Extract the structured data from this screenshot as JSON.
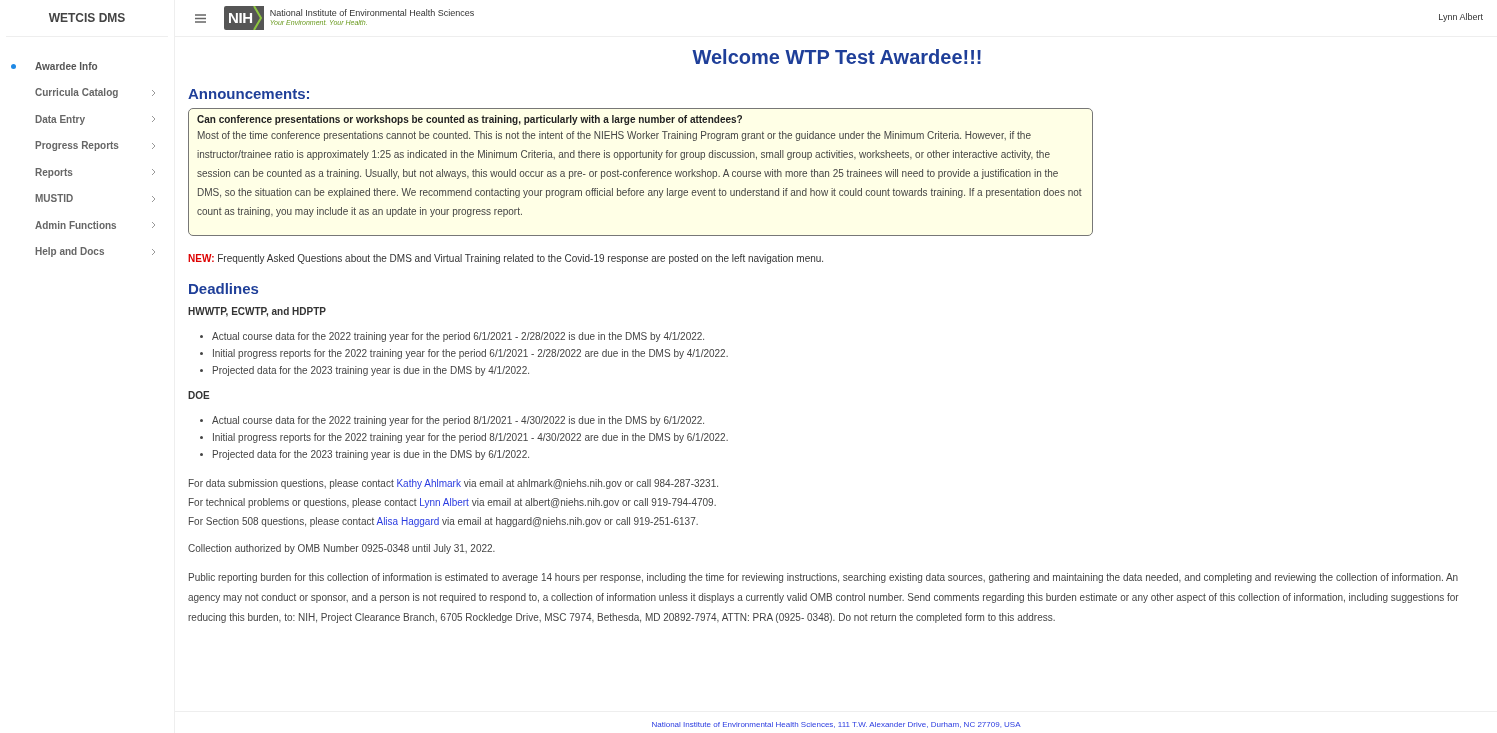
{
  "sidebar": {
    "title": "WETCIS DMS",
    "items": [
      {
        "label": "Awardee Info",
        "selected": true,
        "has_submenu": false
      },
      {
        "label": "Curricula Catalog",
        "selected": false,
        "has_submenu": true
      },
      {
        "label": "Data Entry",
        "selected": false,
        "has_submenu": true
      },
      {
        "label": "Progress Reports",
        "selected": false,
        "has_submenu": true
      },
      {
        "label": "Reports",
        "selected": false,
        "has_submenu": true
      },
      {
        "label": "MUSTID",
        "selected": false,
        "has_submenu": true
      },
      {
        "label": "Admin Functions",
        "selected": false,
        "has_submenu": true
      },
      {
        "label": "Help and Docs",
        "selected": false,
        "has_submenu": true
      }
    ]
  },
  "header": {
    "logo_mark": "NIH",
    "org_name": "National Institute of Environmental Health Sciences",
    "tagline": "Your Environment. Your Health.",
    "user": "Lynn Albert"
  },
  "welcome": "Welcome WTP Test Awardee!!!",
  "announcements": {
    "heading": "Announcements:",
    "question": "Can conference presentations or workshops be counted as training, particularly with a large number of attendees?",
    "answer": "Most of the time conference presentations cannot be counted. This is not the intent of the NIEHS Worker Training Program grant or the guidance under the Minimum Criteria. However, if the instructor/trainee ratio is approximately 1:25 as indicated in the Minimum Criteria, and there is opportunity for group discussion, small group activities, worksheets, or other interactive activity, the session can be counted as a training. Usually, but not always, this would occur as a pre- or post-conference workshop. A course with more than 25 trainees will need to provide a justification in the DMS, so the situation can be explained there. We recommend contacting your program official before any large event to understand if and how it could count towards training. If a presentation does not count as training, you may include it as an update in your progress report."
  },
  "notice": "**NEW:** Frequently Asked Questions about the DMS and Virtual Training related to the Covid-19 response are posted on the left navigation menu.",
  "deadlines": {
    "heading": "Deadlines",
    "groups": [
      {
        "title": "HWWTP, ECWTP, and HDPTP",
        "items": [
          "Actual course data for the 2022 training year for the period 6/1/2021 - 2/28/2022 is due in the DMS by 4/1/2022.",
          "Initial progress reports for the 2022 training year for the period 6/1/2021 - 2/28/2022 are due in the DMS by 4/1/2022.",
          "Projected data for the 2023 training year is due in the DMS by 4/1/2022."
        ]
      },
      {
        "title": "DOE",
        "items": [
          "Actual course data for the 2022 training year for the period 8/1/2021 - 4/30/2022 is due in the DMS by 6/1/2022.",
          "Initial progress reports for the 2022 training year for the period 8/1/2021 - 4/30/2022 are due in the DMS by 6/1/2022.",
          "Projected data for the 2023 training year is due in the DMS by 6/1/2022."
        ]
      }
    ]
  },
  "contacts": [
    {
      "before": "For data submission questions, please contact",
      "link": "Kathy Ahlmark",
      "after": "via email at ahlmark@niehs.nih.gov or call 984-287-3231."
    },
    {
      "before": "For technical problems or questions, please contact",
      "link": "Lynn Albert",
      "after": "via email at albert@niehs.nih.gov or call 919-794-4709."
    },
    {
      "before": "For Section 508 questions, please contact",
      "link": "Alisa Haggard",
      "after": "via email at haggard@niehs.nih.gov or call 919-251-6137."
    }
  ],
  "omb": "Collection authorized by OMB Number 0925-0348 until July 31, 2022.",
  "burden": "Public reporting burden for this collection of information is estimated to average 14 hours per response, including the time for reviewing instructions, searching existing data sources, gathering and maintaining the data needed, and completing and reviewing the collection of information. An agency may not conduct or sponsor, and a person is not required to respond to, a collection of information unless it displays a currently valid OMB control number. Send comments regarding this burden estimate or any other aspect of this collection of information, including suggestions for reducing this burden, to: NIH, Project Clearance Branch, 6705 Rockledge Drive, MSC 7974, Bethesda, MD 20892-7974, ATTN: PRA (0925- 0348). Do not return the completed form to this address.",
  "footer": "National Institute of Environmental Health Sciences, 111 T.W. Alexander Drive, Durham, NC 27709, USA"
}
